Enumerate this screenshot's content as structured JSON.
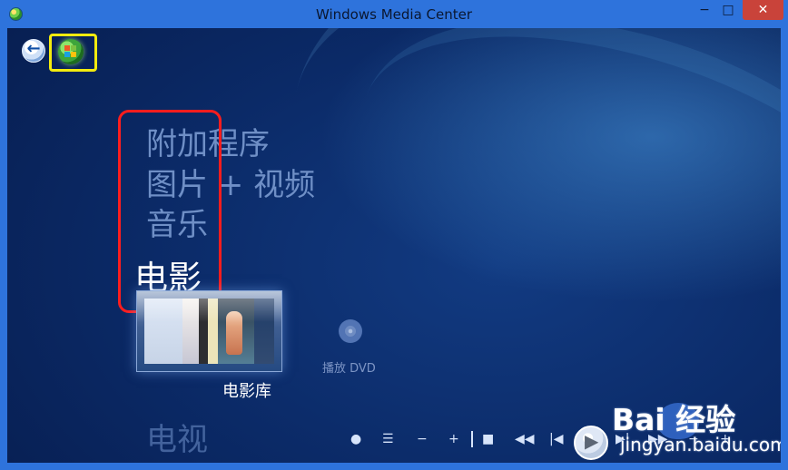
{
  "window": {
    "title": "Windows Media Center",
    "controls": {
      "minimize": "−",
      "maximize": "□",
      "close": "✕"
    }
  },
  "navigation": {
    "back_icon": "←"
  },
  "menu": {
    "items": [
      "附加程序",
      "图片 + 视频",
      "音乐",
      "电影",
      "电视"
    ]
  },
  "media": {
    "tile_label": "电影库",
    "dvd_label": "播放 DVD"
  },
  "playback": {
    "record": "●",
    "list": "☰",
    "volume_down": "−",
    "volume_up": "+",
    "stop": "■",
    "rewind": "◀◀",
    "previous": "|◀",
    "play": "▶",
    "next": "▶|",
    "fast_forward": "▶▶",
    "zoom_out": "−",
    "zoom_in": "+"
  },
  "watermark": {
    "brand": "Bai 经验",
    "url": "jingyan.baidu.com"
  },
  "colors": {
    "title_bar": "#2e73dc",
    "close_button": "#c9433a",
    "background": "#0b2a67",
    "highlight_yellow": "#f3eb0e",
    "highlight_red": "#ff1d1d"
  }
}
